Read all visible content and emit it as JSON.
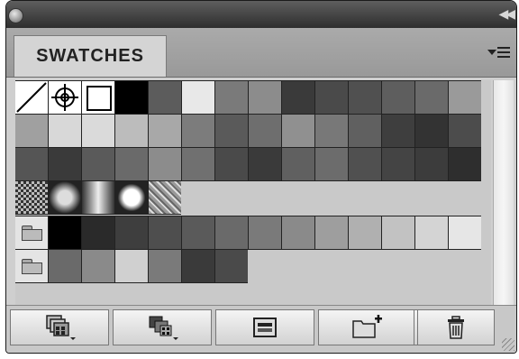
{
  "panel": {
    "tab_label": "SWATCHES"
  },
  "icons": {
    "close": "close-dot-icon",
    "collapse": "double-chevron-icon",
    "menu": "panel-menu-icon"
  },
  "swatch_rows": [
    [
      "none",
      "registration",
      "white",
      "#000000",
      "#5c5c5c",
      "#e8e8e8",
      "#7a7a7a",
      "#8c8c8c",
      "#3a3a3a",
      "#4a4a4a",
      "#505050",
      "#5e5e5e",
      "#6a6a6a",
      "#9a9a9a"
    ],
    [
      "#a0a0a0",
      "#d8d8d8",
      "#dadada",
      "#bcbcbc",
      "#a8a8a8",
      "#7c7c7c",
      "#5a5a5a",
      "#6e6e6e",
      "#909090",
      "#787878",
      "#606060",
      "#3e3e3e",
      "#333333",
      "#4c4c4c"
    ],
    [
      "#555555",
      "#3a3a3a",
      "#5a5a5a",
      "#6a6a6a",
      "#8c8c8c",
      "#707070",
      "#4a4a4a",
      "#3a3a3a",
      "#606060",
      "#6c6c6c",
      "#505050",
      "#444444",
      "#3c3c3c",
      "#2e2e2e"
    ],
    [
      "pattern-checker",
      "gradient-radial-dark",
      "gradient-linear",
      "gradient-radial-white",
      "pattern-texture"
    ]
  ],
  "group_rows": [
    {
      "name": "group-1",
      "swatches": [
        "#000000",
        "#2a2a2a",
        "#3e3e3e",
        "#4e4e4e",
        "#5a5a5a",
        "#6a6a6a",
        "#7a7a7a",
        "#8a8a8a",
        "#9e9e9e",
        "#b0b0b0",
        "#c2c2c2",
        "#d4d4d4",
        "#e6e6e6"
      ]
    },
    {
      "name": "group-2",
      "swatches": [
        "#6a6a6a",
        "#8a8a8a",
        "#d0d0d0",
        "#7a7a7a",
        "#3a3a3a",
        "#4a4a4a"
      ]
    }
  ],
  "bottom_buttons": [
    {
      "name": "swatch-libraries-menu-button",
      "icon": "swatch-library-icon"
    },
    {
      "name": "show-swatch-kinds-button",
      "icon": "swatch-kinds-icon"
    },
    {
      "name": "swatch-options-button",
      "icon": "swatch-options-icon"
    },
    {
      "name": "new-color-group-button",
      "icon": "new-folder-icon"
    },
    {
      "name": "new-swatch-button",
      "icon": "new-swatch-icon"
    },
    {
      "name": "delete-swatch-button",
      "icon": "trash-icon"
    }
  ]
}
